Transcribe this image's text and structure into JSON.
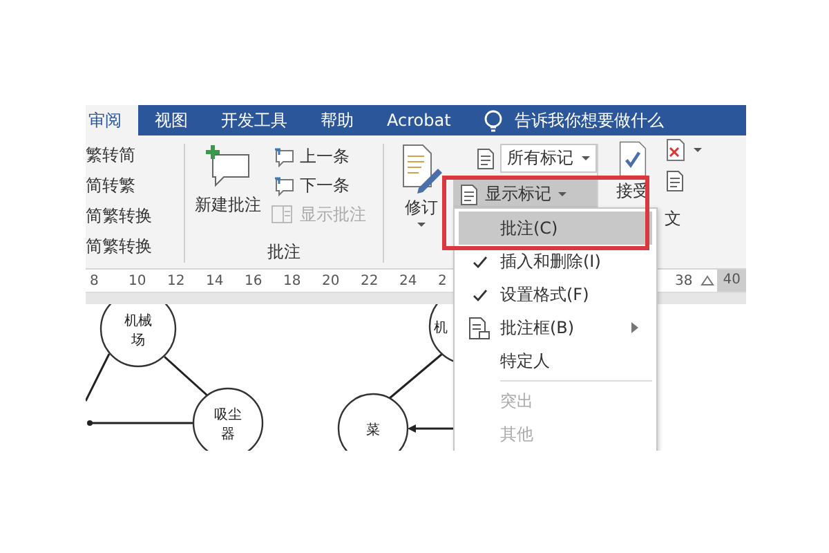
{
  "tabs": [
    {
      "label": "审阅",
      "selected": true
    },
    {
      "label": "视图",
      "selected": false
    },
    {
      "label": "开发工具",
      "selected": false
    },
    {
      "label": "帮助",
      "selected": false
    },
    {
      "label": "Acrobat",
      "selected": false
    }
  ],
  "tell_me": {
    "placeholder": "告诉我你想要做什么"
  },
  "ribbon": {
    "chinese_conversion": {
      "items": [
        "繁转简",
        "简转繁",
        "简繁转换",
        "简繁转换"
      ]
    },
    "comments": {
      "new_comment": "新建批注",
      "previous": {
        "label": "上一条",
        "disabled": false
      },
      "next": {
        "label": "下一条",
        "disabled": false
      },
      "show_comments": {
        "label": "显示批注",
        "disabled": true
      },
      "group_label": "批注"
    },
    "tracking": {
      "track_changes": "修订",
      "markup_dropdown": {
        "value": "所有标记"
      },
      "show_markup": {
        "label": "显示标记",
        "pressed": true
      }
    },
    "changes": {
      "accept": "接受",
      "group_label_fragment": "文"
    }
  },
  "ruler": {
    "left_ticks": [
      "8",
      "10",
      "12",
      "14",
      "16",
      "18",
      "20",
      "22",
      "24",
      "2"
    ],
    "right_ticks": [
      "38",
      "40"
    ]
  },
  "diagram": {
    "nodes": [
      {
        "lines": [
          "机械",
          "场"
        ]
      },
      {
        "lines": [
          "吸尘",
          "器"
        ]
      },
      {
        "lines": [
          "菜"
        ]
      },
      {
        "lines": [
          "机"
        ]
      }
    ]
  },
  "menu": {
    "items": [
      {
        "kind": "plain",
        "label": "批注(C)",
        "selected": true,
        "checked": false,
        "disabled": false,
        "submenu": false
      },
      {
        "kind": "plain",
        "label": "插入和删除(I)",
        "selected": false,
        "checked": true,
        "disabled": false,
        "submenu": false
      },
      {
        "kind": "plain",
        "label": "设置格式(F)",
        "selected": false,
        "checked": true,
        "disabled": false,
        "submenu": false
      },
      {
        "kind": "icon",
        "label": "批注框(B)",
        "selected": false,
        "checked": false,
        "disabled": false,
        "submenu": true
      },
      {
        "kind": "plain",
        "label": "特定人",
        "selected": false,
        "checked": false,
        "disabled": false,
        "submenu": false
      },
      {
        "kind": "separator"
      },
      {
        "kind": "plain",
        "label": "突出",
        "selected": false,
        "checked": false,
        "disabled": true,
        "submenu": false
      },
      {
        "kind": "plain",
        "label": "其他",
        "selected": false,
        "checked": false,
        "disabled": true,
        "submenu": false
      }
    ]
  }
}
